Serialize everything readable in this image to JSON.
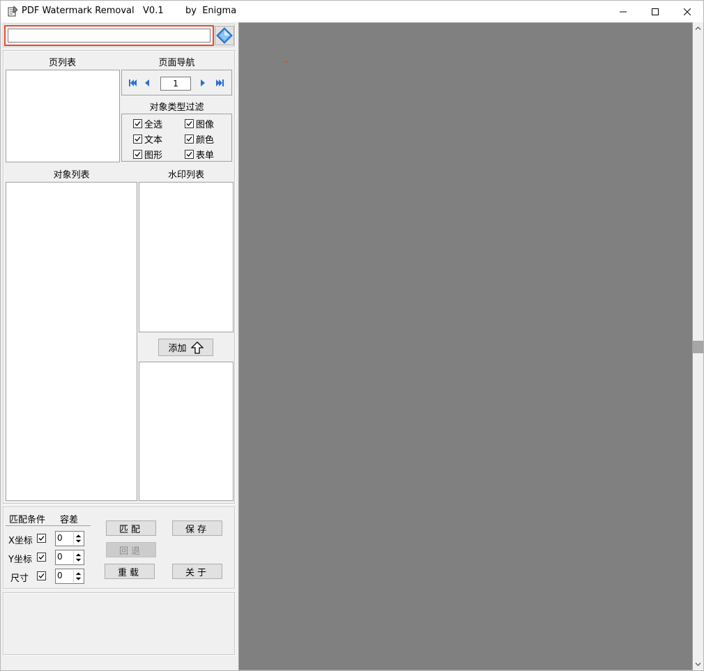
{
  "window": {
    "title": "PDF Watermark Removal   V0.1",
    "author": "by  Enigma",
    "icon": "notepad-edit-icon",
    "controls": [
      "minimize-icon",
      "maximize-icon",
      "close-icon"
    ]
  },
  "toolbar": {
    "path_value": "",
    "open_icon": "open-file-icon"
  },
  "pages": {
    "title": "页列表"
  },
  "navigation": {
    "title": "页面导航",
    "current_page": "1",
    "icons": [
      "first-page-icon",
      "prev-page-icon",
      "next-page-icon",
      "last-page-icon"
    ]
  },
  "filter": {
    "title": "对象类型过滤",
    "items": [
      {
        "label": "全选",
        "checked": true
      },
      {
        "label": "图像",
        "checked": true
      },
      {
        "label": "文本",
        "checked": true
      },
      {
        "label": "颜色",
        "checked": true
      },
      {
        "label": "图形",
        "checked": true
      },
      {
        "label": "表单",
        "checked": true
      }
    ]
  },
  "objects": {
    "title": "对象列表"
  },
  "watermarks": {
    "title": "水印列表",
    "add_label": "添加"
  },
  "match": {
    "condition_title": "匹配条件",
    "tolerance_title": "容差",
    "rows": [
      {
        "label": "X坐标",
        "checked": true,
        "value": "0"
      },
      {
        "label": "Y坐标",
        "checked": true,
        "value": "0"
      },
      {
        "label": "尺寸",
        "checked": true,
        "value": "0"
      }
    ],
    "buttons": {
      "match": "匹配",
      "save": "保存",
      "undo": "回退",
      "reload": "重载",
      "about": "关于"
    }
  },
  "colors": {
    "accent_border": "#e8432a",
    "viewer_bg": "#808080",
    "nav_blue": "#2a6fd6"
  }
}
